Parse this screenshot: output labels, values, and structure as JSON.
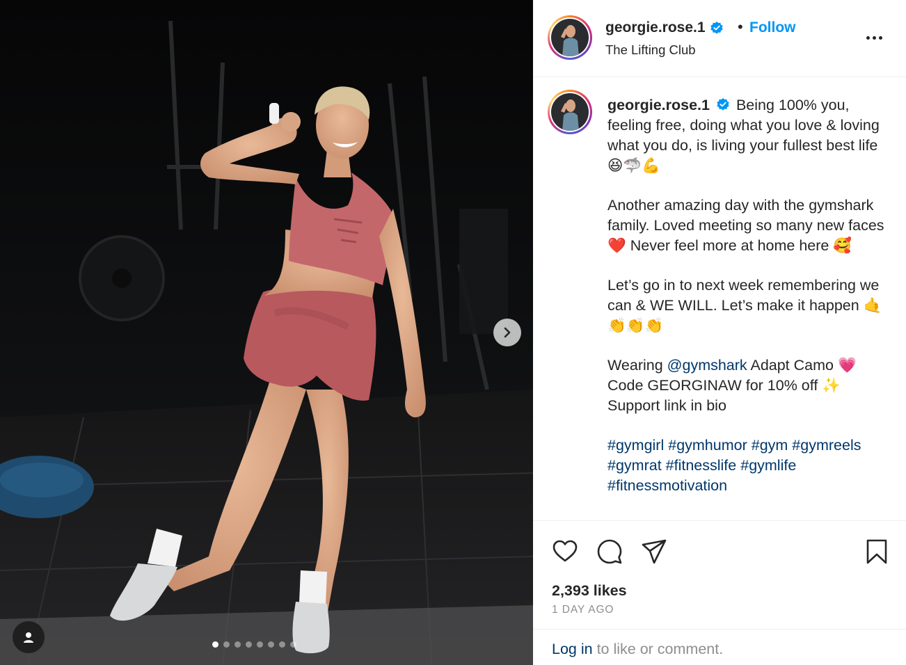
{
  "post": {
    "username": "georgie.rose.1",
    "location": "The Lifting Club",
    "follow_label": "Follow",
    "separator": "•",
    "caption": {
      "line1": "Being 100% you, feeling free, doing what you love & loving what you do, is living your fullest best life 😆🦈💪",
      "line2": "Another amazing day with the gymshark family. Loved meeting so many new faces ❤️ Never feel more at home here 🥰",
      "line3": "Let’s go in to next week remembering we can & WE WILL. Let’s make it happen 🤙👏👏👏",
      "line4_prefix": "Wearing ",
      "mention": "@gymshark",
      "line4_suffix": " Adapt Camo 💗",
      "line5": "Code GEORGINAW for 10% off ✨",
      "line6": "Support link in bio",
      "hashtags": [
        "#gymgirl",
        "#gymhumor",
        "#gym",
        "#gymreels",
        "#gymrat",
        "#fitnesslife",
        "#gymlife",
        "#fitnessmotivation"
      ]
    },
    "likes": "2,393 likes",
    "timestamp": "1 DAY AGO",
    "login_link": "Log in",
    "login_suffix": " to like or comment.",
    "carousel_total": 8,
    "carousel_active": 1
  },
  "icons": {
    "verified": "verified-badge-icon",
    "more": "more-options-icon",
    "like": "heart-icon",
    "comment": "comment-icon",
    "share": "share-icon",
    "save": "bookmark-icon",
    "next": "chevron-right-icon",
    "tag": "user-tag-icon"
  },
  "colors": {
    "accent": "#0095f6",
    "link": "#00376b",
    "muted": "#8e8e8e",
    "text": "#262626"
  }
}
